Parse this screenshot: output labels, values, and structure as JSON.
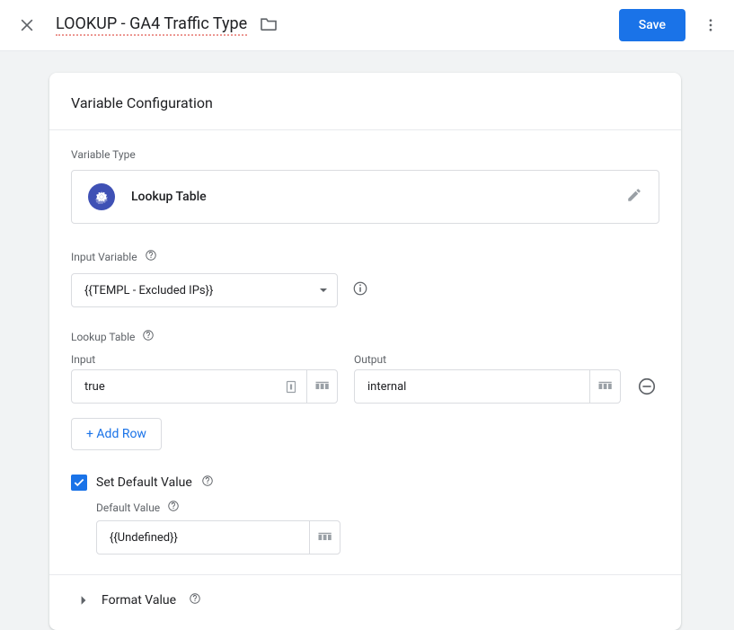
{
  "header": {
    "title": "LOOKUP - GA4 Traffic Type",
    "save_label": "Save"
  },
  "card": {
    "heading": "Variable Configuration",
    "variable_type_label": "Variable Type",
    "variable_type_name": "Lookup Table",
    "input_variable_label": "Input Variable",
    "input_variable_value": "{{TEMPL - Excluded IPs}}",
    "lookup_table_label": "Lookup Table",
    "col_input_label": "Input",
    "col_output_label": "Output",
    "rows": [
      {
        "input": "true",
        "output": "internal"
      }
    ],
    "add_row_label": "+ Add Row",
    "set_default_label": "Set Default Value",
    "default_value_label": "Default Value",
    "default_value": "{{Undefined}}",
    "format_value_label": "Format Value"
  }
}
